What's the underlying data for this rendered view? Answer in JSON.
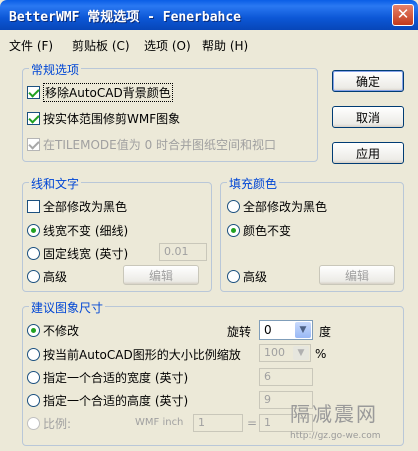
{
  "window": {
    "title": "BetterWMF 常规选项 - Fenerbahce",
    "close_glyph": "✕"
  },
  "menu": [
    "文件 (F)",
    "剪贴板 (C)",
    "选项 (O)",
    "帮助 (H)"
  ],
  "general": {
    "title": "常规选项",
    "opt1": "移除AutoCAD背景颜色",
    "opt2": "按实体范围修剪WMF图象",
    "opt3": "在TILEMODE值为 0 时合并图纸空间和视口"
  },
  "buttons": {
    "ok": "确定",
    "cancel": "取消",
    "apply": "应用"
  },
  "lines": {
    "title": "线和文字",
    "all_black": "全部修改为黑色",
    "width_unchanged": "线宽不变 (细线)",
    "fixed_width": "固定线宽 (英寸)",
    "fixed_width_value": "0.01",
    "advanced": "高级",
    "edit": "编辑"
  },
  "fill": {
    "title": "填充颜色",
    "all_black": "全部修改为黑色",
    "color_unchanged": "颜色不变",
    "advanced": "高级",
    "edit": "编辑"
  },
  "size": {
    "title": "建议图象尺寸",
    "no_change": "不修改",
    "rotate_label": "旋转",
    "rotate_value": "0",
    "degree": "度",
    "scale": "按当前AutoCAD图形的大小比例缩放",
    "scale_value": "100",
    "percent": "%",
    "width": "指定一个合适的宽度 (英寸)",
    "width_value": "6",
    "height": "指定一个合适的高度 (英寸)",
    "height_value": "9",
    "ratio": "比例:",
    "wmf_inch": "WMF inch",
    "ratio_left": "1",
    "equals": "=",
    "ratio_right": "1"
  },
  "watermark": {
    "text": "隔减震网",
    "url": "http://gz.go-we.com"
  }
}
